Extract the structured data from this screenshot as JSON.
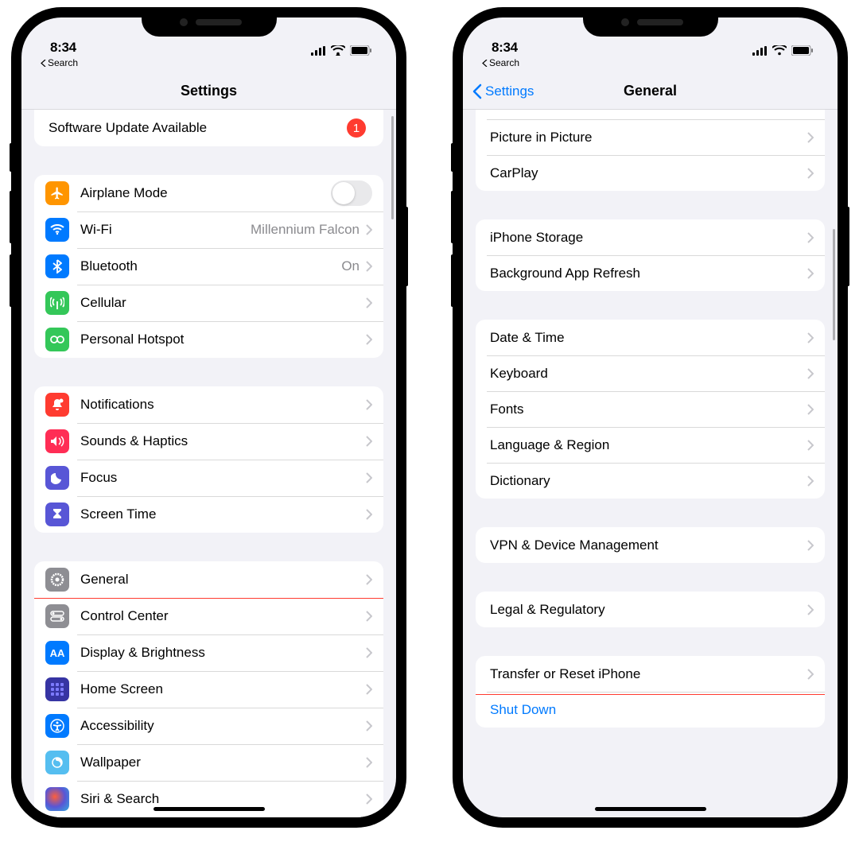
{
  "status": {
    "time": "8:34",
    "back_search": "Search"
  },
  "phone1": {
    "nav_title": "Settings",
    "software_update": {
      "label": "Software Update Available",
      "badge": "1"
    },
    "group_connect": [
      {
        "icon": "airplane",
        "color": "#ff9500",
        "label": "Airplane Mode",
        "toggle": true
      },
      {
        "icon": "wifi",
        "color": "#007aff",
        "label": "Wi-Fi",
        "detail": "Millennium Falcon"
      },
      {
        "icon": "bluetooth",
        "color": "#007aff",
        "label": "Bluetooth",
        "detail": "On"
      },
      {
        "icon": "cellular",
        "color": "#34c759",
        "label": "Cellular"
      },
      {
        "icon": "hotspot",
        "color": "#34c759",
        "label": "Personal Hotspot"
      }
    ],
    "group_notif": [
      {
        "icon": "bell",
        "color": "#ff3b30",
        "label": "Notifications"
      },
      {
        "icon": "speaker",
        "color": "#ff2d55",
        "label": "Sounds & Haptics"
      },
      {
        "icon": "moon",
        "color": "#5856d6",
        "label": "Focus"
      },
      {
        "icon": "hourglass",
        "color": "#5856d6",
        "label": "Screen Time"
      }
    ],
    "group_general": [
      {
        "icon": "gear",
        "color": "#8e8e93",
        "label": "General",
        "highlight": true
      },
      {
        "icon": "switches",
        "color": "#8e8e93",
        "label": "Control Center"
      },
      {
        "icon": "aa",
        "color": "#007aff",
        "label": "Display & Brightness"
      },
      {
        "icon": "grid",
        "color": "#3a3ac8",
        "label": "Home Screen"
      },
      {
        "icon": "accessibility",
        "color": "#007aff",
        "label": "Accessibility"
      },
      {
        "icon": "wallpaper",
        "color": "#55bef0",
        "label": "Wallpaper"
      },
      {
        "icon": "siri",
        "color": "#1c1c1e",
        "label": "Siri & Search"
      }
    ]
  },
  "phone2": {
    "nav_back": "Settings",
    "nav_title": "General",
    "group_top": [
      {
        "label": "Picture in Picture"
      },
      {
        "label": "CarPlay"
      }
    ],
    "group_storage": [
      {
        "label": "iPhone Storage"
      },
      {
        "label": "Background App Refresh"
      }
    ],
    "group_lang": [
      {
        "label": "Date & Time"
      },
      {
        "label": "Keyboard"
      },
      {
        "label": "Fonts"
      },
      {
        "label": "Language & Region"
      },
      {
        "label": "Dictionary"
      }
    ],
    "group_vpn": [
      {
        "label": "VPN & Device Management"
      }
    ],
    "group_legal": [
      {
        "label": "Legal & Regulatory"
      }
    ],
    "group_reset": [
      {
        "label": "Transfer or Reset iPhone",
        "highlight": true
      },
      {
        "label": "Shut Down",
        "link": true
      }
    ]
  }
}
